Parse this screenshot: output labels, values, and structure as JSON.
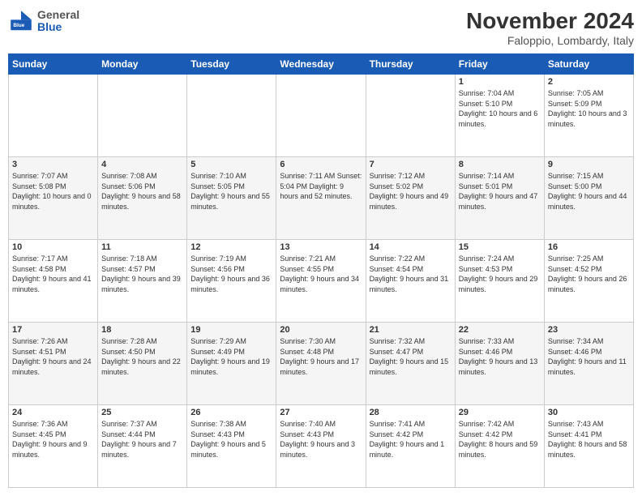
{
  "logo": {
    "general": "General",
    "blue": "Blue"
  },
  "header": {
    "month": "November 2024",
    "location": "Faloppio, Lombardy, Italy"
  },
  "weekdays": [
    "Sunday",
    "Monday",
    "Tuesday",
    "Wednesday",
    "Thursday",
    "Friday",
    "Saturday"
  ],
  "weeks": [
    [
      {
        "day": "",
        "info": ""
      },
      {
        "day": "",
        "info": ""
      },
      {
        "day": "",
        "info": ""
      },
      {
        "day": "",
        "info": ""
      },
      {
        "day": "",
        "info": ""
      },
      {
        "day": "1",
        "info": "Sunrise: 7:04 AM\nSunset: 5:10 PM\nDaylight: 10 hours and 6 minutes."
      },
      {
        "day": "2",
        "info": "Sunrise: 7:05 AM\nSunset: 5:09 PM\nDaylight: 10 hours and 3 minutes."
      }
    ],
    [
      {
        "day": "3",
        "info": "Sunrise: 7:07 AM\nSunset: 5:08 PM\nDaylight: 10 hours and 0 minutes."
      },
      {
        "day": "4",
        "info": "Sunrise: 7:08 AM\nSunset: 5:06 PM\nDaylight: 9 hours and 58 minutes."
      },
      {
        "day": "5",
        "info": "Sunrise: 7:10 AM\nSunset: 5:05 PM\nDaylight: 9 hours and 55 minutes."
      },
      {
        "day": "6",
        "info": "Sunrise: 7:11 AM\nSunset: 5:04 PM\nDaylight: 9 hours and 52 minutes."
      },
      {
        "day": "7",
        "info": "Sunrise: 7:12 AM\nSunset: 5:02 PM\nDaylight: 9 hours and 49 minutes."
      },
      {
        "day": "8",
        "info": "Sunrise: 7:14 AM\nSunset: 5:01 PM\nDaylight: 9 hours and 47 minutes."
      },
      {
        "day": "9",
        "info": "Sunrise: 7:15 AM\nSunset: 5:00 PM\nDaylight: 9 hours and 44 minutes."
      }
    ],
    [
      {
        "day": "10",
        "info": "Sunrise: 7:17 AM\nSunset: 4:58 PM\nDaylight: 9 hours and 41 minutes."
      },
      {
        "day": "11",
        "info": "Sunrise: 7:18 AM\nSunset: 4:57 PM\nDaylight: 9 hours and 39 minutes."
      },
      {
        "day": "12",
        "info": "Sunrise: 7:19 AM\nSunset: 4:56 PM\nDaylight: 9 hours and 36 minutes."
      },
      {
        "day": "13",
        "info": "Sunrise: 7:21 AM\nSunset: 4:55 PM\nDaylight: 9 hours and 34 minutes."
      },
      {
        "day": "14",
        "info": "Sunrise: 7:22 AM\nSunset: 4:54 PM\nDaylight: 9 hours and 31 minutes."
      },
      {
        "day": "15",
        "info": "Sunrise: 7:24 AM\nSunset: 4:53 PM\nDaylight: 9 hours and 29 minutes."
      },
      {
        "day": "16",
        "info": "Sunrise: 7:25 AM\nSunset: 4:52 PM\nDaylight: 9 hours and 26 minutes."
      }
    ],
    [
      {
        "day": "17",
        "info": "Sunrise: 7:26 AM\nSunset: 4:51 PM\nDaylight: 9 hours and 24 minutes."
      },
      {
        "day": "18",
        "info": "Sunrise: 7:28 AM\nSunset: 4:50 PM\nDaylight: 9 hours and 22 minutes."
      },
      {
        "day": "19",
        "info": "Sunrise: 7:29 AM\nSunset: 4:49 PM\nDaylight: 9 hours and 19 minutes."
      },
      {
        "day": "20",
        "info": "Sunrise: 7:30 AM\nSunset: 4:48 PM\nDaylight: 9 hours and 17 minutes."
      },
      {
        "day": "21",
        "info": "Sunrise: 7:32 AM\nSunset: 4:47 PM\nDaylight: 9 hours and 15 minutes."
      },
      {
        "day": "22",
        "info": "Sunrise: 7:33 AM\nSunset: 4:46 PM\nDaylight: 9 hours and 13 minutes."
      },
      {
        "day": "23",
        "info": "Sunrise: 7:34 AM\nSunset: 4:46 PM\nDaylight: 9 hours and 11 minutes."
      }
    ],
    [
      {
        "day": "24",
        "info": "Sunrise: 7:36 AM\nSunset: 4:45 PM\nDaylight: 9 hours and 9 minutes."
      },
      {
        "day": "25",
        "info": "Sunrise: 7:37 AM\nSunset: 4:44 PM\nDaylight: 9 hours and 7 minutes."
      },
      {
        "day": "26",
        "info": "Sunrise: 7:38 AM\nSunset: 4:43 PM\nDaylight: 9 hours and 5 minutes."
      },
      {
        "day": "27",
        "info": "Sunrise: 7:40 AM\nSunset: 4:43 PM\nDaylight: 9 hours and 3 minutes."
      },
      {
        "day": "28",
        "info": "Sunrise: 7:41 AM\nSunset: 4:42 PM\nDaylight: 9 hours and 1 minute."
      },
      {
        "day": "29",
        "info": "Sunrise: 7:42 AM\nSunset: 4:42 PM\nDaylight: 8 hours and 59 minutes."
      },
      {
        "day": "30",
        "info": "Sunrise: 7:43 AM\nSunset: 4:41 PM\nDaylight: 8 hours and 58 minutes."
      }
    ]
  ]
}
